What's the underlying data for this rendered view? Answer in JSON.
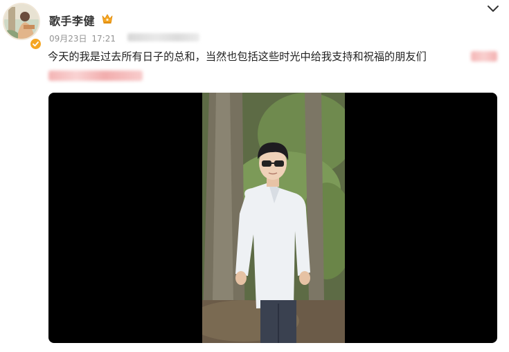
{
  "author": {
    "name": "歌手李健",
    "verified": true,
    "badge": "crown-icon"
  },
  "meta": {
    "date": "09月23日",
    "time": "17:21"
  },
  "post": {
    "text": "今天的我是过去所有日子的总和，当然也包括这些时光中给我支持和祝福的朋友们"
  },
  "media": {
    "type": "video",
    "content": "man in white shirt and sunglasses standing in front of trees"
  },
  "icons": {
    "menu": "chevron-down-icon",
    "verified": "verified-badge-icon"
  },
  "colors": {
    "username": "#333333",
    "meta": "#939393",
    "text": "#222222",
    "verified": "#f5a623",
    "video_bg": "#000000"
  }
}
